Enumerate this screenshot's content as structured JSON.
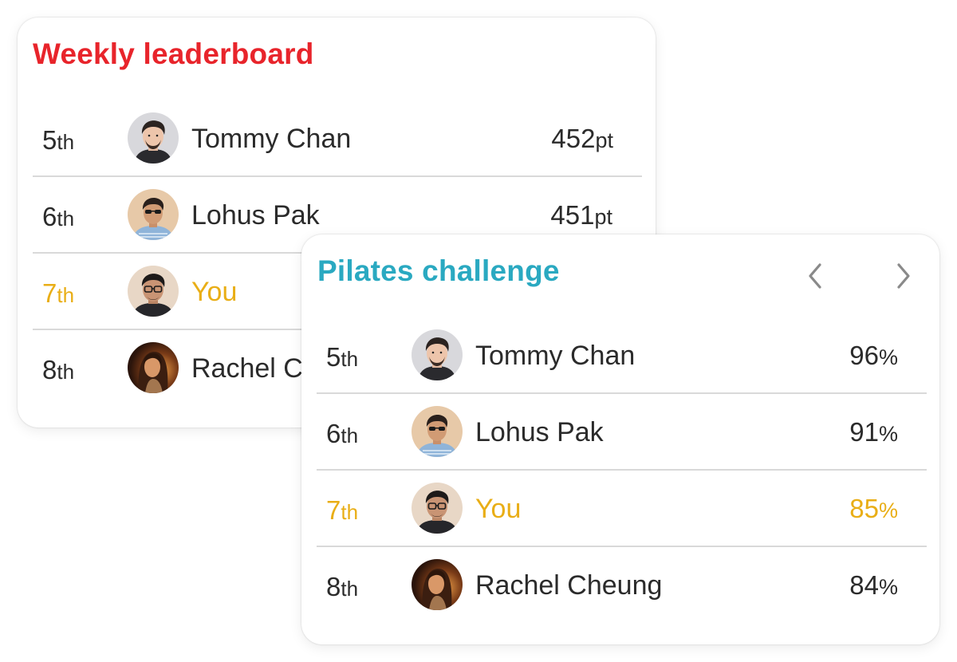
{
  "weekly_leaderboard": {
    "title": "Weekly leaderboard",
    "title_color": "#e8242b",
    "rows": [
      {
        "rank": "5",
        "suffix": "th",
        "name": "Tommy Chan",
        "score": "452",
        "unit": "pt",
        "avatar": "tommy-avatar"
      },
      {
        "rank": "6",
        "suffix": "th",
        "name": "Lohus Pak",
        "score": "451",
        "unit": "pt",
        "avatar": "lohus-avatar"
      },
      {
        "rank": "7",
        "suffix": "th",
        "name": "You",
        "score": "",
        "unit": "",
        "avatar": "you-avatar",
        "highlight": true
      },
      {
        "rank": "8",
        "suffix": "th",
        "name": "Rachel C",
        "score": "",
        "unit": "",
        "avatar": "rachel-avatar"
      }
    ]
  },
  "pilates_challenge": {
    "title": "Pilates challenge",
    "title_color": "#2aa9c1",
    "nav": {
      "prev_icon": "chevron-left-icon",
      "next_icon": "chevron-right-icon"
    },
    "rows": [
      {
        "rank": "5",
        "suffix": "th",
        "name": "Tommy Chan",
        "score": "96",
        "unit": "%",
        "avatar": "tommy-avatar"
      },
      {
        "rank": "6",
        "suffix": "th",
        "name": "Lohus Pak",
        "score": "91",
        "unit": "%",
        "avatar": "lohus-avatar"
      },
      {
        "rank": "7",
        "suffix": "th",
        "name": "You",
        "score": "85",
        "unit": "%",
        "avatar": "you-avatar",
        "highlight": true
      },
      {
        "rank": "8",
        "suffix": "th",
        "name": "Rachel Cheung",
        "score": "84",
        "unit": "%",
        "avatar": "rachel-avatar"
      }
    ]
  },
  "colors": {
    "highlight": "#e9ae16",
    "divider": "#d9d9d9",
    "text": "#2b2b2b",
    "chevron": "#8a8a8a"
  }
}
